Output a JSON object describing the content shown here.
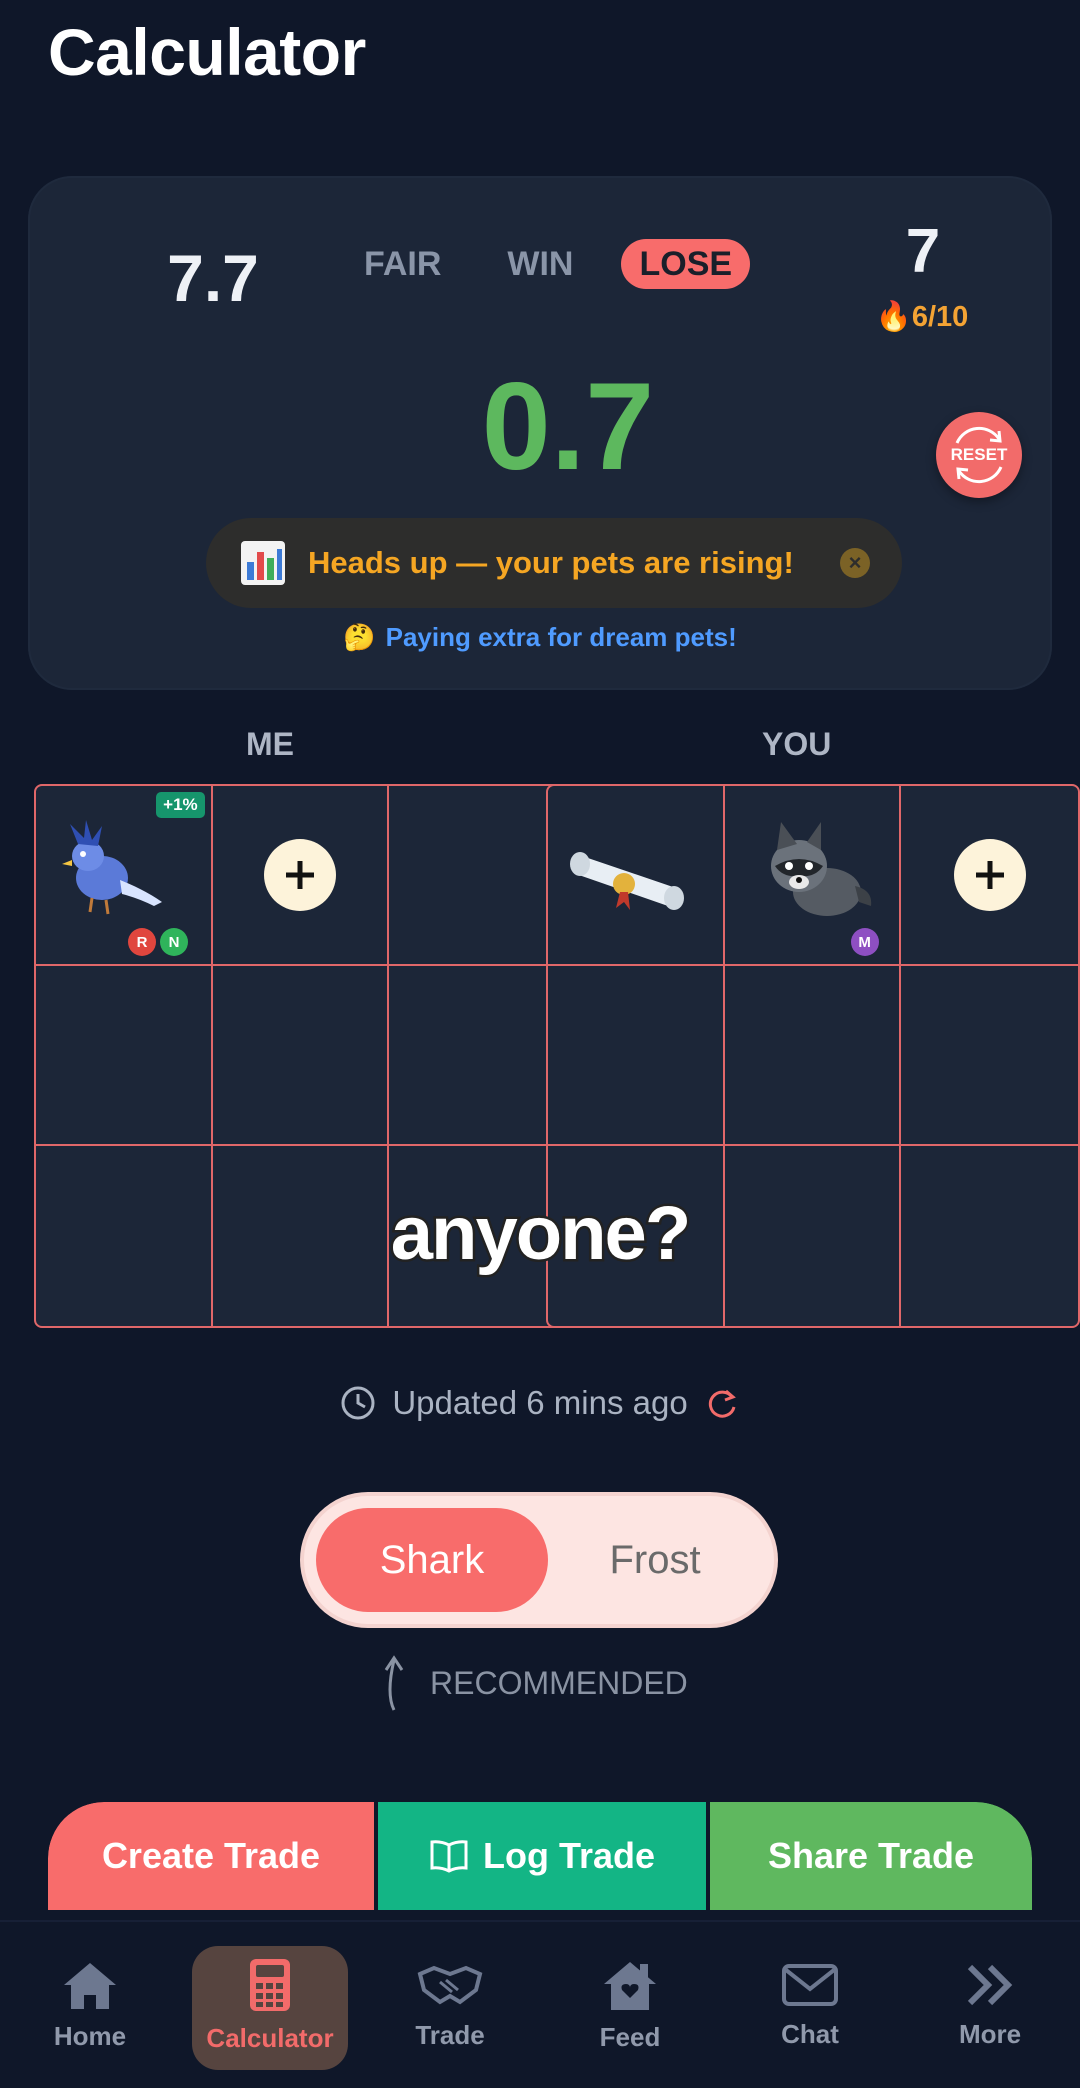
{
  "header": {
    "title": "Calculator"
  },
  "summary": {
    "my_value": "7.7",
    "their_value": "7",
    "streak": "6/10",
    "difference": "0.7",
    "tabs": [
      "FAIR",
      "WIN",
      "LOSE"
    ],
    "active_tab": "LOSE",
    "reset_label": "RESET",
    "alert": "Heads up — your pets are rising!",
    "hint": "Paying extra for dream pets!"
  },
  "me": {
    "label": "ME",
    "pet_badge": "+1%",
    "pet_tags": [
      "R",
      "N"
    ]
  },
  "you": {
    "label": "YOU",
    "pet_tags": [
      "M"
    ]
  },
  "overlay_caption": "anyone?",
  "status": {
    "updated": "Updated 6 mins ago"
  },
  "value_source": {
    "options": [
      "Shark",
      "Frost"
    ],
    "selected": "Shark",
    "recommended_label": "RECOMMENDED"
  },
  "actions": {
    "create": "Create Trade",
    "log": "Log Trade",
    "share": "Share Trade"
  },
  "nav": {
    "items": [
      "Home",
      "Calculator",
      "Trade",
      "Feed",
      "Chat",
      "More"
    ],
    "active": "Calculator"
  },
  "colors": {
    "background": "#0f1729",
    "accent_red": "#f86c6b",
    "win_green": "#5db85e",
    "teal": "#13b585",
    "warning": "#f5a623"
  }
}
